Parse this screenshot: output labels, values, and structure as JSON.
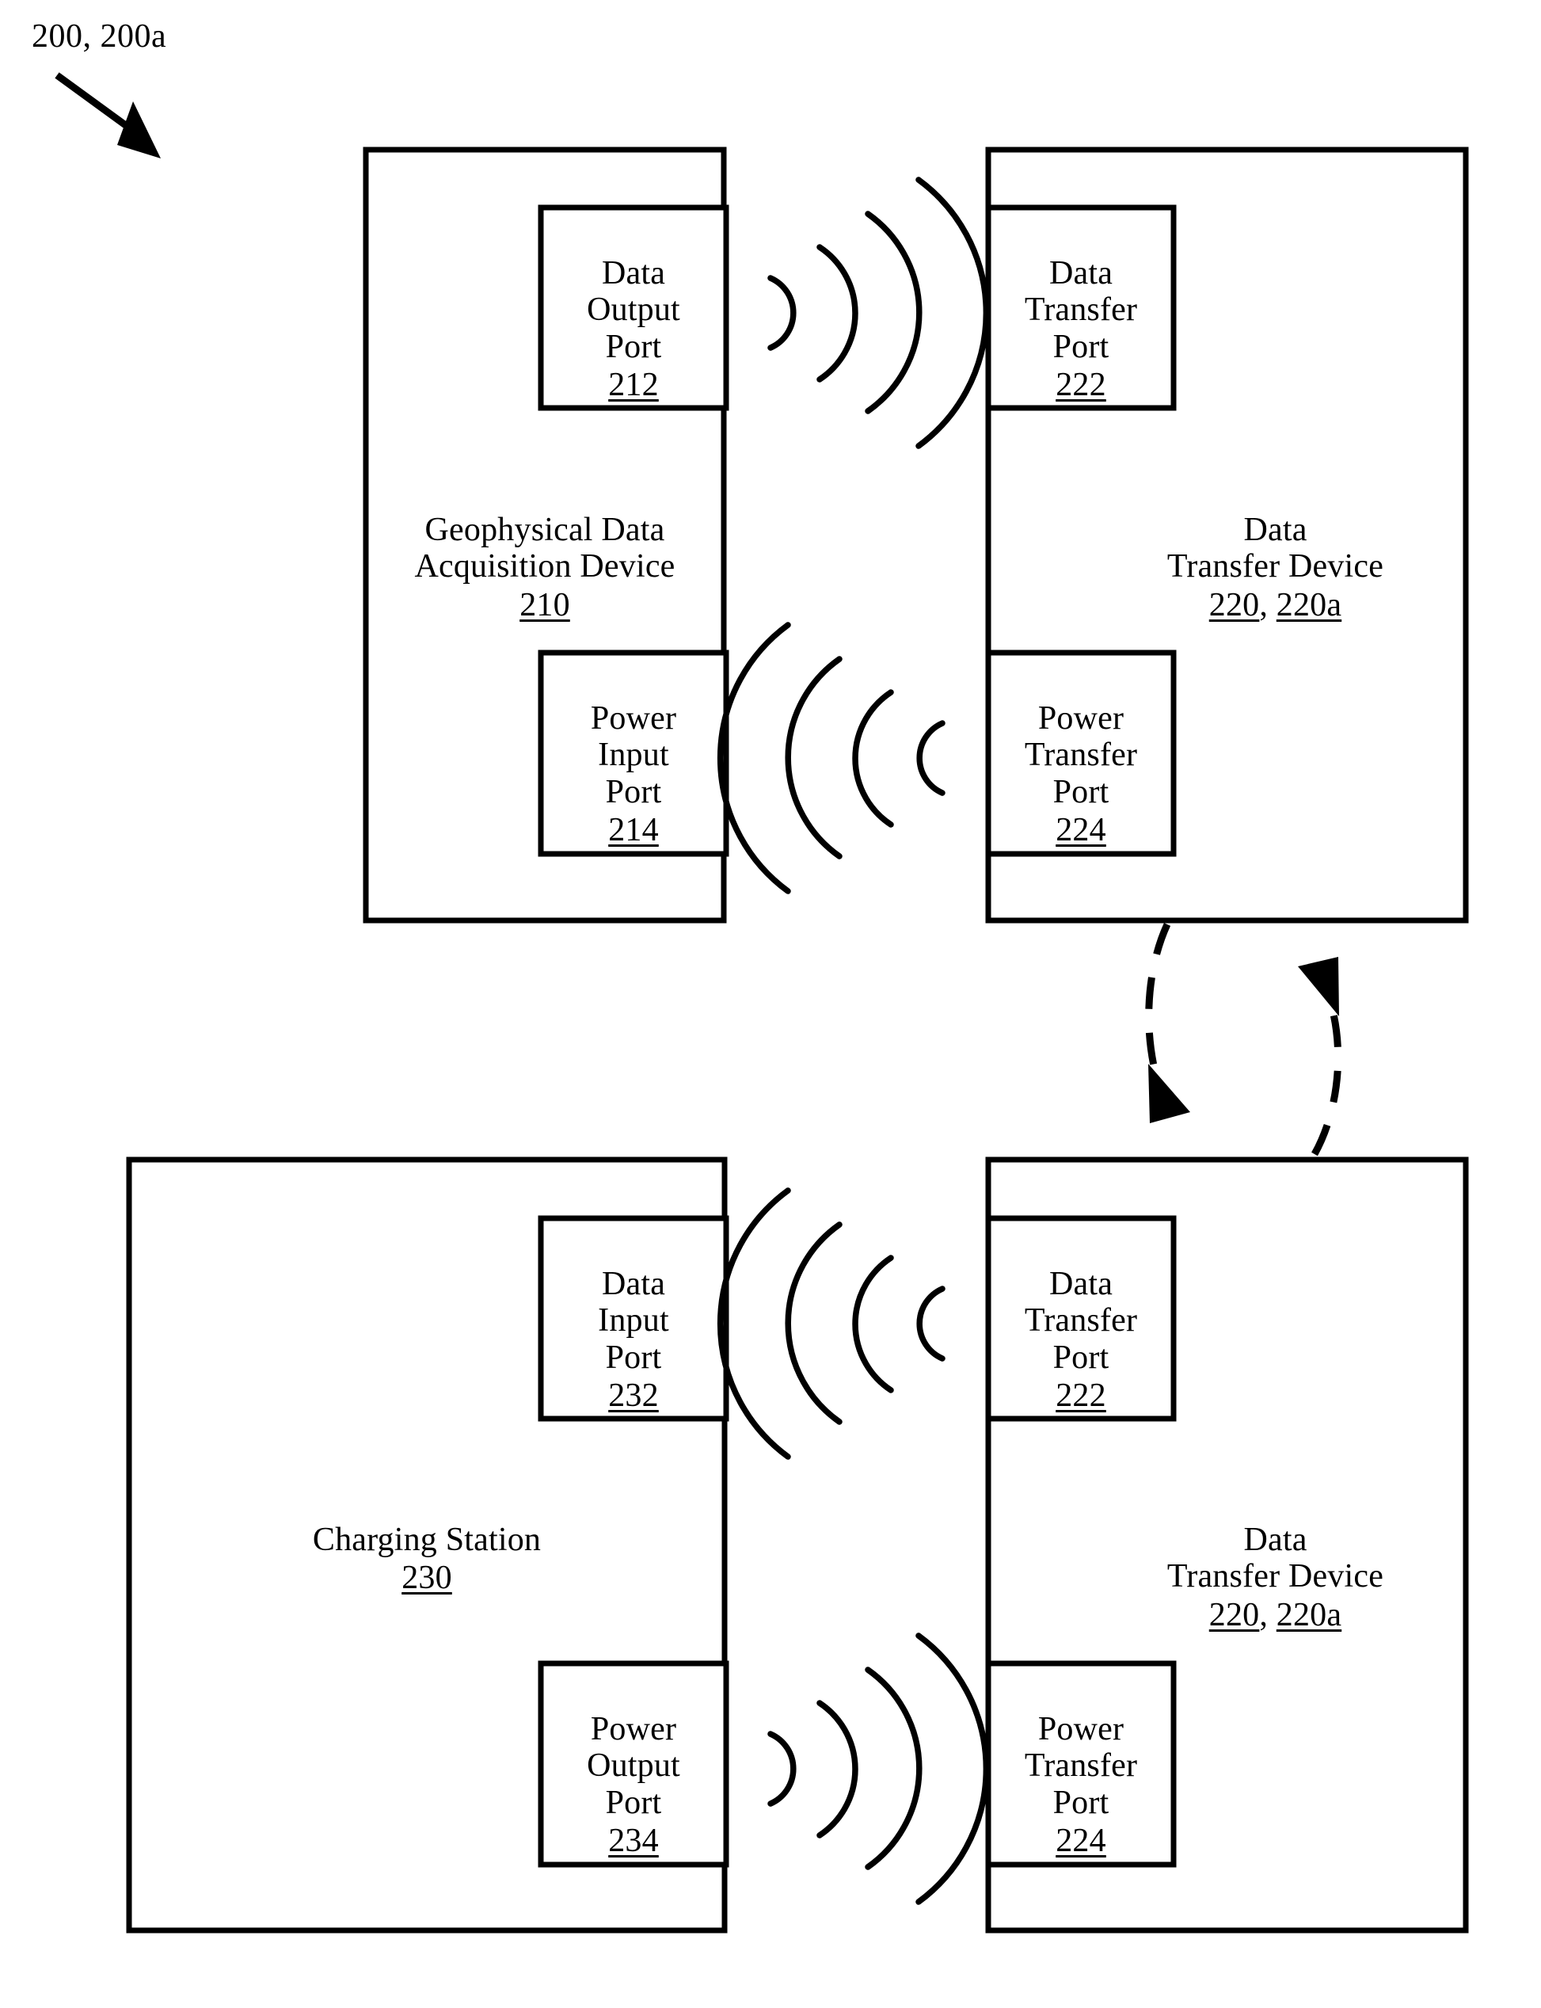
{
  "figure": {
    "label": "200, 200a",
    "arrow_icon": "diagonal-arrow-icon"
  },
  "top_section": {
    "acquisition_device": {
      "title": "Geophysical Data\nAcquisition Device",
      "ref": "210",
      "ports": [
        {
          "name": "data-output-port",
          "title": "Data\nOutput\nPort",
          "ref": "212"
        },
        {
          "name": "power-input-port",
          "title": "Power\nInput\nPort",
          "ref": "214"
        }
      ]
    },
    "transfer_device": {
      "title": "Data\nTransfer Device",
      "ref_a": "220",
      "ref_sep": ", ",
      "ref_b": "220a",
      "ports": [
        {
          "name": "data-transfer-port",
          "title": "Data\nTransfer\nPort",
          "ref": "222"
        },
        {
          "name": "power-transfer-port",
          "title": "Power\nTransfer\nPort",
          "ref": "224"
        }
      ]
    },
    "wireless_links": [
      {
        "name": "data-wireless-link-top",
        "direction": "left-to-right",
        "arcs": 4
      },
      {
        "name": "power-wireless-link-top",
        "direction": "right-to-left",
        "arcs": 4
      }
    ]
  },
  "middle": {
    "cycle_arrows": [
      {
        "name": "transfer-down-arrow",
        "style": "dashed",
        "direction": "down"
      },
      {
        "name": "transfer-up-arrow",
        "style": "dashed",
        "direction": "up"
      }
    ]
  },
  "bottom_section": {
    "charging_station": {
      "title": "Charging Station",
      "ref": "230",
      "ports": [
        {
          "name": "data-input-port",
          "title": "Data\nInput\nPort",
          "ref": "232"
        },
        {
          "name": "power-output-port",
          "title": "Power\nOutput\nPort",
          "ref": "234"
        }
      ]
    },
    "transfer_device": {
      "title": "Data\nTransfer Device",
      "ref_a": "220",
      "ref_sep": ", ",
      "ref_b": "220a",
      "ports": [
        {
          "name": "data-transfer-port",
          "title": "Data\nTransfer\nPort",
          "ref": "222"
        },
        {
          "name": "power-transfer-port",
          "title": "Power\nTransfer\nPort",
          "ref": "224"
        }
      ]
    },
    "wireless_links": [
      {
        "name": "data-wireless-link-bottom",
        "direction": "right-to-left",
        "arcs": 4
      },
      {
        "name": "power-wireless-link-bottom",
        "direction": "left-to-right",
        "arcs": 4
      }
    ]
  },
  "style": {
    "ink": "#000000",
    "paper": "#ffffff"
  }
}
